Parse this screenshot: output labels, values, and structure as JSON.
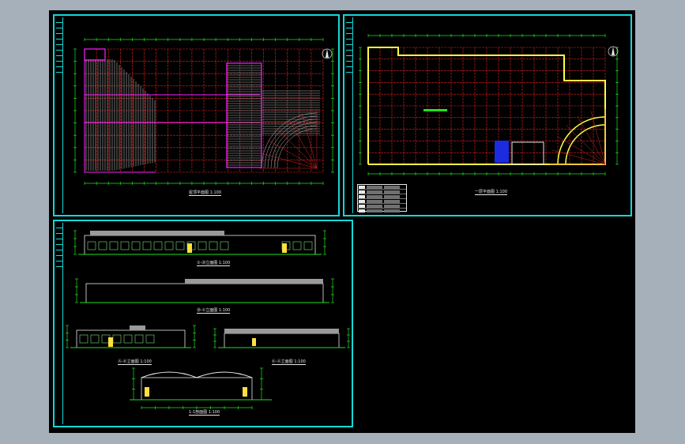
{
  "sheets": {
    "roof_plan": {
      "caption": "屋顶平面图 1:100"
    },
    "floor_plan": {
      "caption": "一层平面图 1:100"
    },
    "elevations": {
      "captions": [
        "①-⑳立面图 1:100",
        "⑳-①立面图 1:100",
        "Ⓐ-Ⓚ立面图 1:100",
        "Ⓚ-Ⓐ立面图 1:100",
        "1-1剖面图 1:100"
      ]
    }
  },
  "colors": {
    "background": "#000000",
    "sheet_border": "#16d7d7",
    "grid": "#e02020",
    "dimension": "#20e020",
    "roof_outline": "#ff20ff",
    "wall": "#ffff40",
    "text": "#e8e8e8"
  },
  "icons": {
    "north_arrow": "north-arrow-icon"
  }
}
